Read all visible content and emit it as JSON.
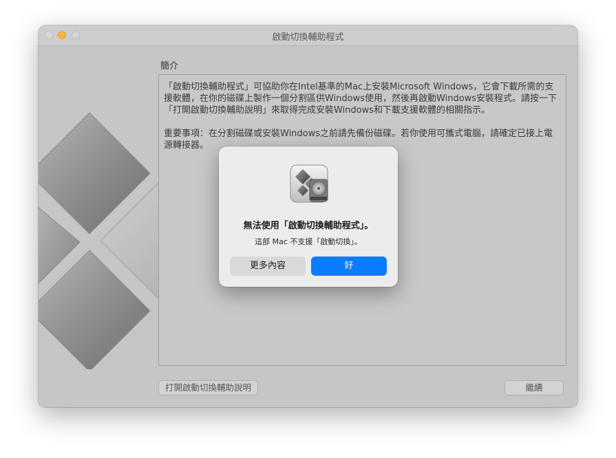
{
  "window": {
    "title": "啟動切換輔助程式",
    "traffic_lights": [
      "close",
      "minimize",
      "zoom"
    ]
  },
  "main": {
    "section_title": "簡介",
    "paragraph_1": "「啟動切換輔助程式」可協助你在Intel基準的Mac上安裝Microsoft Windows，它會下載所需的支援軟體，在你的磁碟上製作一個分割區供Windows使用，然後再啟動Windows安裝程式。請按一下「打開啟動切換輔助說明」來取得完成安裝Windows和下載支援軟體的相關指示。",
    "paragraph_2": "重要事項：在分割磁碟或安裝Windows之前請先備份磁碟。若你使用可攜式電腦，請確定已接上電源轉接器。",
    "help_button": "打開啟動切換輔助說明",
    "continue_button": "繼續"
  },
  "alert": {
    "icon": "boot-camp-assistant-icon",
    "title": "無法使用「啟動切換輔助程式」。",
    "message": "這部 Mac 不支援「啟動切換」。",
    "more_button": "更多內容",
    "ok_button": "好"
  },
  "colors": {
    "accent": "#0a7dff",
    "window_bg": "#c6c6c6",
    "minimize": "#f6b43a"
  }
}
